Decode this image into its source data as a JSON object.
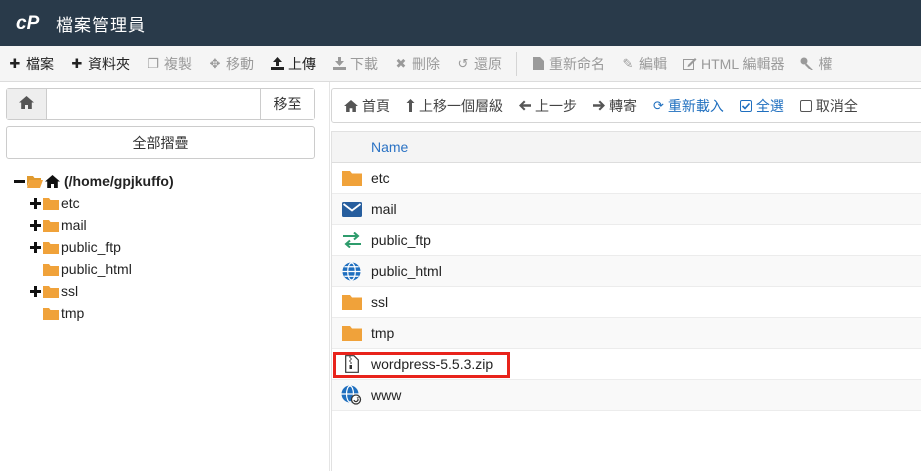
{
  "app": {
    "title": "檔案管理員",
    "logo": "cP"
  },
  "toolbar": {
    "items": [
      {
        "label": "檔案",
        "icon": "plus-icon",
        "enabled": true
      },
      {
        "label": "資料夾",
        "icon": "plus-icon",
        "enabled": true
      },
      {
        "label": "複製",
        "icon": "copy-icon",
        "enabled": false
      },
      {
        "label": "移動",
        "icon": "move-icon",
        "enabled": false
      },
      {
        "label": "上傳",
        "icon": "upload-icon",
        "enabled": true
      },
      {
        "label": "下載",
        "icon": "download-icon",
        "enabled": false
      },
      {
        "label": "刪除",
        "icon": "close-icon",
        "enabled": false
      },
      {
        "label": "還原",
        "icon": "undo-icon",
        "enabled": false
      },
      {
        "label": "重新命名",
        "icon": "file-icon",
        "enabled": false
      },
      {
        "label": "編輯",
        "icon": "pencil-icon",
        "enabled": false
      },
      {
        "label": "HTML 編輯器",
        "icon": "edit-box-icon",
        "enabled": false
      },
      {
        "label": "權",
        "icon": "key-icon",
        "enabled": false
      }
    ]
  },
  "left": {
    "path_value": "",
    "go_label": "移至",
    "collapse_label": "全部摺疊",
    "tree": {
      "root_label": "(/home/gpjkuffo)",
      "children": [
        {
          "label": "etc",
          "expandable": true
        },
        {
          "label": "mail",
          "expandable": true
        },
        {
          "label": "public_ftp",
          "expandable": true
        },
        {
          "label": "public_html",
          "expandable": false
        },
        {
          "label": "ssl",
          "expandable": true
        },
        {
          "label": "tmp",
          "expandable": false
        }
      ]
    }
  },
  "nav": {
    "home": "首頁",
    "up": "上移一個層級",
    "back": "上一步",
    "forward": "轉寄",
    "reload": "重新載入",
    "select_all": "全選",
    "deselect_all": "取消全"
  },
  "files": {
    "header_name": "Name",
    "rows": [
      {
        "name": "etc",
        "icon": "folder-icon"
      },
      {
        "name": "mail",
        "icon": "mail-icon"
      },
      {
        "name": "public_ftp",
        "icon": "transfer-icon"
      },
      {
        "name": "public_html",
        "icon": "globe-icon"
      },
      {
        "name": "ssl",
        "icon": "folder-icon"
      },
      {
        "name": "tmp",
        "icon": "folder-icon"
      },
      {
        "name": "wordpress-5.5.3.zip",
        "icon": "zip-file-icon"
      },
      {
        "name": "www",
        "icon": "globe-link-icon"
      }
    ]
  },
  "colors": {
    "header_bg": "#293a4a",
    "folder": "#f0a23a",
    "link_blue": "#2a72c4",
    "highlight": "#e8231b"
  }
}
